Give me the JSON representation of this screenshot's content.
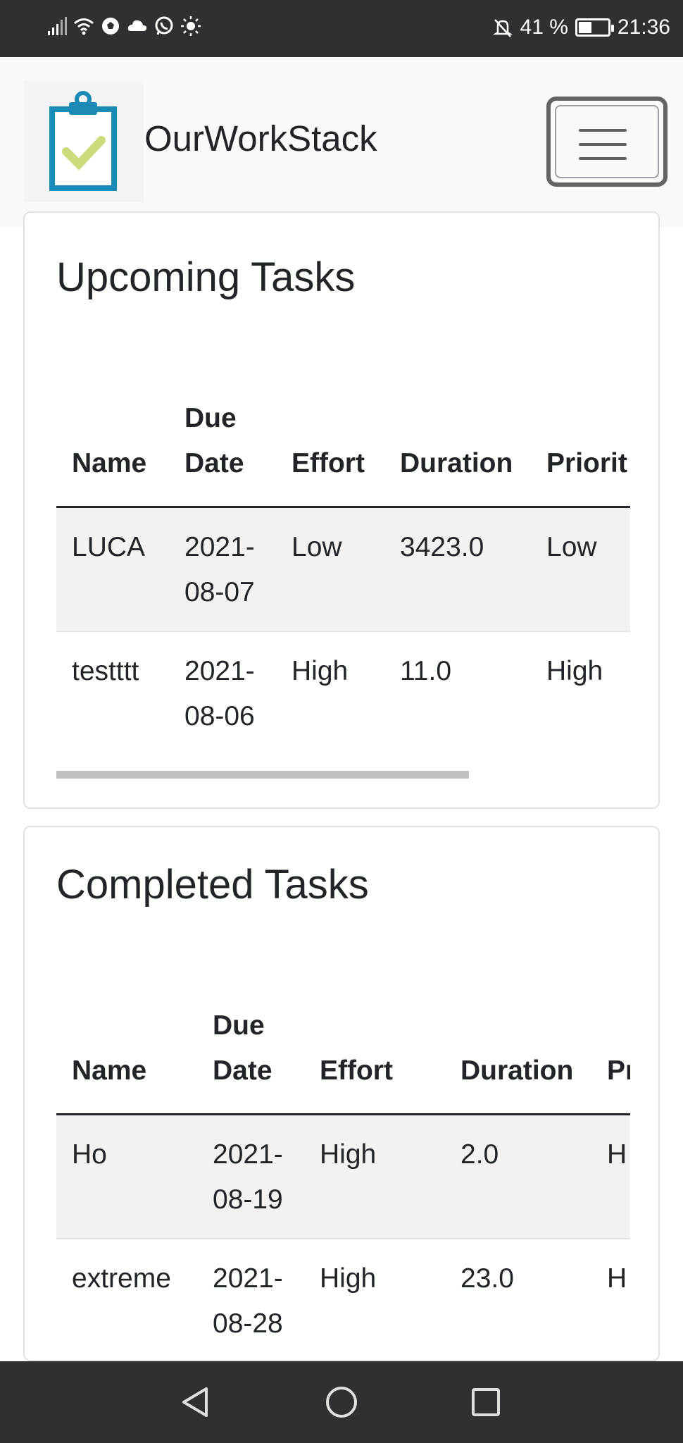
{
  "status_bar": {
    "battery": "41 %",
    "battery_level": 0.41,
    "time": "21:36",
    "left_icons": [
      "signal-icon",
      "wifi-icon",
      "soccer-ball-icon",
      "cloud-icon",
      "whatsapp-icon",
      "brightness-icon"
    ],
    "right_icons": [
      "mute-notifications-icon",
      "battery-icon"
    ]
  },
  "navbar": {
    "brand": "OurWorkStack",
    "logo_icon": "clipboard-check-icon",
    "menu_icon": "hamburger-menu-icon",
    "colors": {
      "logo_blue": "#1b8ab4",
      "logo_check": "#c9de7b",
      "navbar_bg": "#f8f9fa"
    }
  },
  "upcoming": {
    "title": "Upcoming Tasks",
    "headers": [
      "Name",
      "Due Date",
      "Effort",
      "Duration",
      "Priorit"
    ],
    "rows": [
      [
        "LUCA",
        "2021-08-07",
        "Low",
        "3423.0",
        "Low"
      ],
      [
        "testttt",
        "2021-08-06",
        "High",
        "11.0",
        "High"
      ]
    ]
  },
  "completed": {
    "title": "Completed Tasks",
    "headers": [
      "Name",
      "Due Date",
      "Effort",
      "Duration",
      "Pr"
    ],
    "rows": [
      [
        "Ho",
        "2021-08-19",
        "High",
        "2.0",
        "H"
      ],
      [
        "extreme",
        "2021-08-28",
        "High",
        "23.0",
        "H"
      ]
    ]
  },
  "bottom_nav": {
    "icons": [
      "back-triangle-icon",
      "home-circle-icon",
      "recents-square-icon"
    ]
  }
}
